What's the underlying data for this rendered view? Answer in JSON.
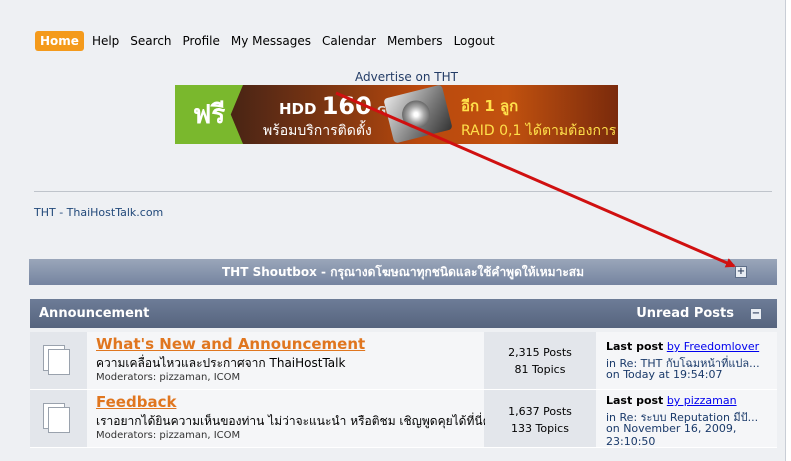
{
  "nav": {
    "home": "Home",
    "help": "Help",
    "search": "Search",
    "profile": "Profile",
    "messages": "My Messages",
    "calendar": "Calendar",
    "members": "Members",
    "logout": "Logout"
  },
  "ad": {
    "label": "Advertise on THT",
    "free": "ฟรี",
    "hdd": "HDD",
    "hdd_size": "160",
    "hdd_unit": "GB",
    "setup": "พร้อมบริการติดตั้ง",
    "more": "อีก 1 ลูก",
    "raid": "RAID 0,1 ได้ตามต้องการ"
  },
  "site_link": "THT - ThaiHostTalk.com",
  "shoutbox": {
    "title": "THT Shoutbox - กรุณางดโฆษณาทุกชนิดและใช้คำพูดให้เหมาะสม",
    "toggle": "+"
  },
  "announcement": {
    "title": "Announcement",
    "unread": "Unread Posts",
    "toggle": "−"
  },
  "forums": [
    {
      "title": "What's New and Announcement",
      "desc": "ความเคลื่อนไหวและประกาศจาก ThaiHostTalk",
      "mods": "Moderators: pizzaman, ICOM",
      "posts": "2,315 Posts",
      "topics": "81 Topics",
      "last_label": "Last post",
      "last_by": "by Freedomlover",
      "last_in": "in Re: THT กับโฉมหน้าที่แปล...",
      "last_on": "on Today at 19:54:07"
    },
    {
      "title": "Feedback",
      "desc": "เราอยากได้ยินความเห็นของท่าน ไม่ว่าจะแนะนำ หรือติชม เชิญพูดคุยได้ที่นี่ครับ",
      "mods": "Moderators: pizzaman, ICOM",
      "posts": "1,637 Posts",
      "topics": "133 Topics",
      "last_label": "Last post",
      "last_by": "by pizzaman",
      "last_in": "in Re: ระบบ Reputation มีปั...",
      "last_on": "on November 16, 2009,",
      "last_time": "23:10:50"
    }
  ],
  "colors": {
    "accent": "#f49a1b",
    "header": "#6d7c97",
    "arrow": "#d01010"
  }
}
